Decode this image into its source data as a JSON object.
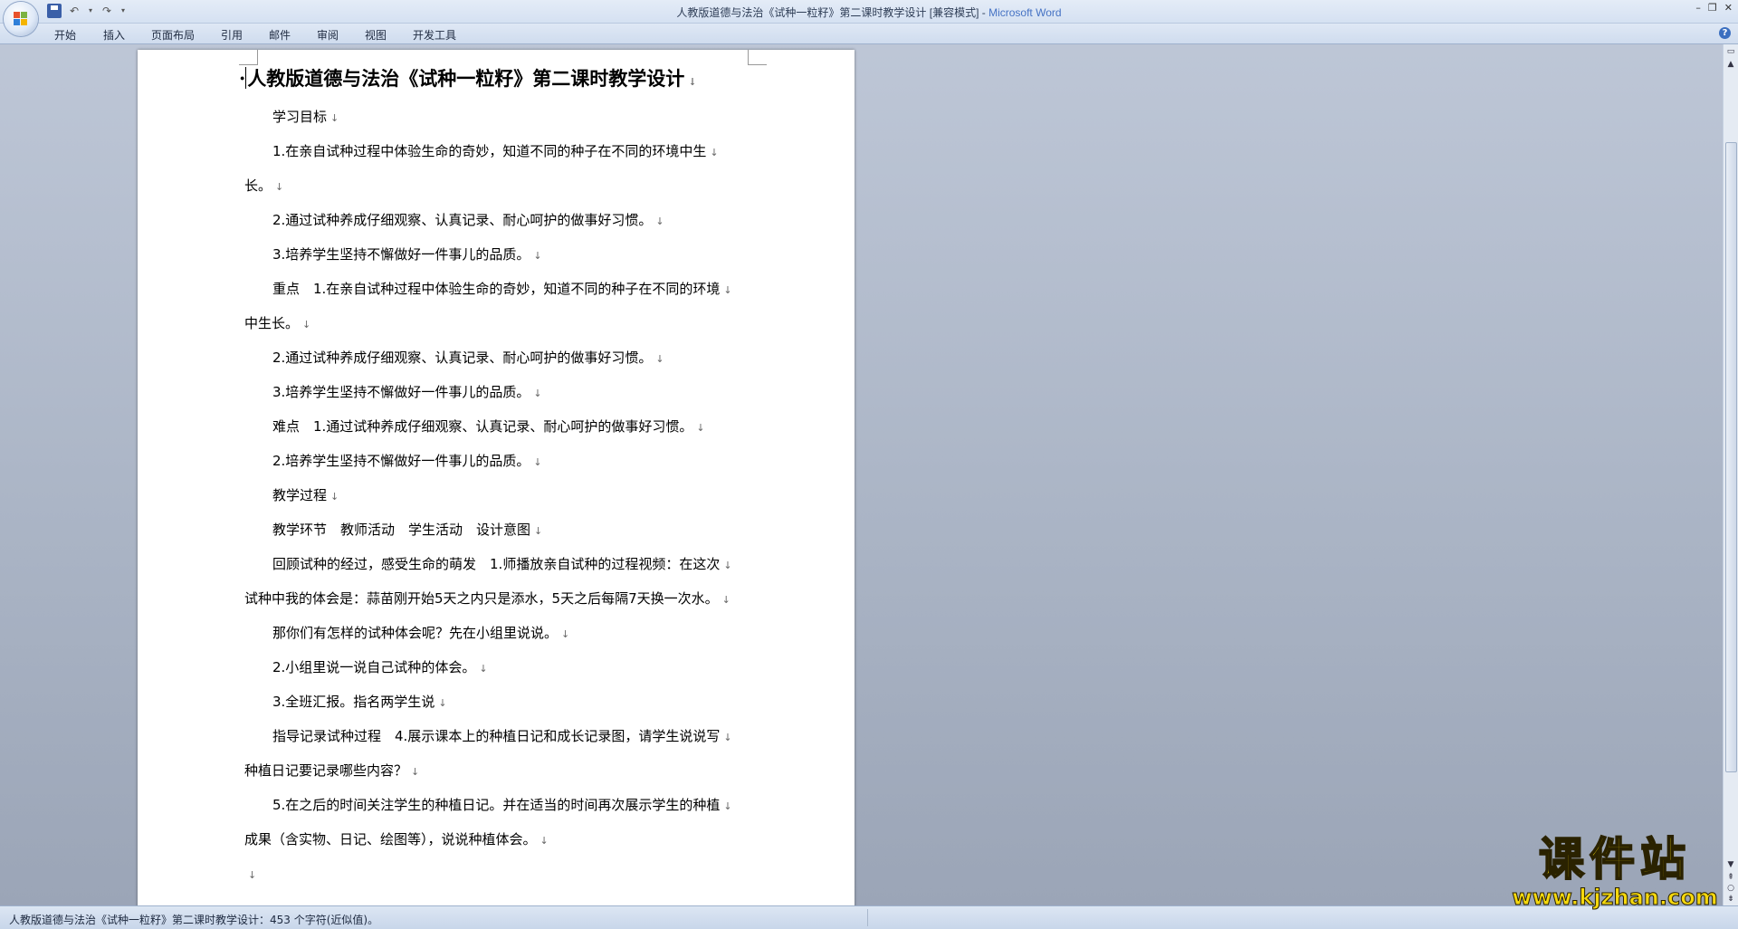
{
  "window": {
    "title_doc": "人教版道德与法治《试种一粒籽》第二课时教学设计 [兼容模式] - ",
    "title_app": "Microsoft Word"
  },
  "ribbon": {
    "tabs": [
      "开始",
      "插入",
      "页面布局",
      "引用",
      "邮件",
      "审阅",
      "视图",
      "开发工具"
    ]
  },
  "document": {
    "title": "人教版道德与法治《试种一粒籽》第二课时教学设计",
    "lines": [
      {
        "text": "学习目标",
        "indent": true
      },
      {
        "text": "1.在亲自试种过程中体验生命的奇妙，知道不同的种子在不同的环境中生",
        "indent": true
      },
      {
        "text": "长。",
        "indent": false
      },
      {
        "text": "2.通过试种养成仔细观察、认真记录、耐心呵护的做事好习惯。",
        "indent": true
      },
      {
        "text": "3.培养学生坚持不懈做好一件事儿的品质。",
        "indent": true
      },
      {
        "text": "重点　1.在亲自试种过程中体验生命的奇妙，知道不同的种子在不同的环境",
        "indent": true
      },
      {
        "text": "中生长。",
        "indent": false
      },
      {
        "text": "2.通过试种养成仔细观察、认真记录、耐心呵护的做事好习惯。",
        "indent": true
      },
      {
        "text": "3.培养学生坚持不懈做好一件事儿的品质。",
        "indent": true
      },
      {
        "text": "难点　1.通过试种养成仔细观察、认真记录、耐心呵护的做事好习惯。",
        "indent": true
      },
      {
        "text": "2.培养学生坚持不懈做好一件事儿的品质。",
        "indent": true
      },
      {
        "text": "教学过程",
        "indent": true
      },
      {
        "text": "教学环节　教师活动　学生活动　设计意图",
        "indent": true
      },
      {
        "text": "回顾试种的经过，感受生命的萌发　1.师播放亲自试种的过程视频：在这次",
        "indent": true
      },
      {
        "text": "试种中我的体会是：蒜苗刚开始5天之内只是添水，5天之后每隔7天换一次水。",
        "indent": false
      },
      {
        "text": "那你们有怎样的试种体会呢？先在小组里说说。",
        "indent": true
      },
      {
        "text": "2.小组里说一说自己试种的体会。",
        "indent": true
      },
      {
        "text": "3.全班汇报。指名两学生说",
        "indent": true
      },
      {
        "text": "指导记录试种过程　4.展示课本上的种植日记和成长记录图，请学生说说写",
        "indent": true
      },
      {
        "text": "种植日记要记录哪些内容？",
        "indent": false
      },
      {
        "text": "5.在之后的时间关注学生的种植日记。并在适当的时间再次展示学生的种植",
        "indent": true
      },
      {
        "text": "成果（含实物、日记、绘图等），说说种植体会。",
        "indent": false
      },
      {
        "text": "",
        "indent": false
      }
    ],
    "paragraph_mark": "↓"
  },
  "statusbar": {
    "text": "人教版道德与法治《试种一粒籽》第二课时教学设计：453 个字符(近似值)。"
  },
  "watermark": {
    "name": "课件站",
    "url": "www.kjzhan.com"
  }
}
